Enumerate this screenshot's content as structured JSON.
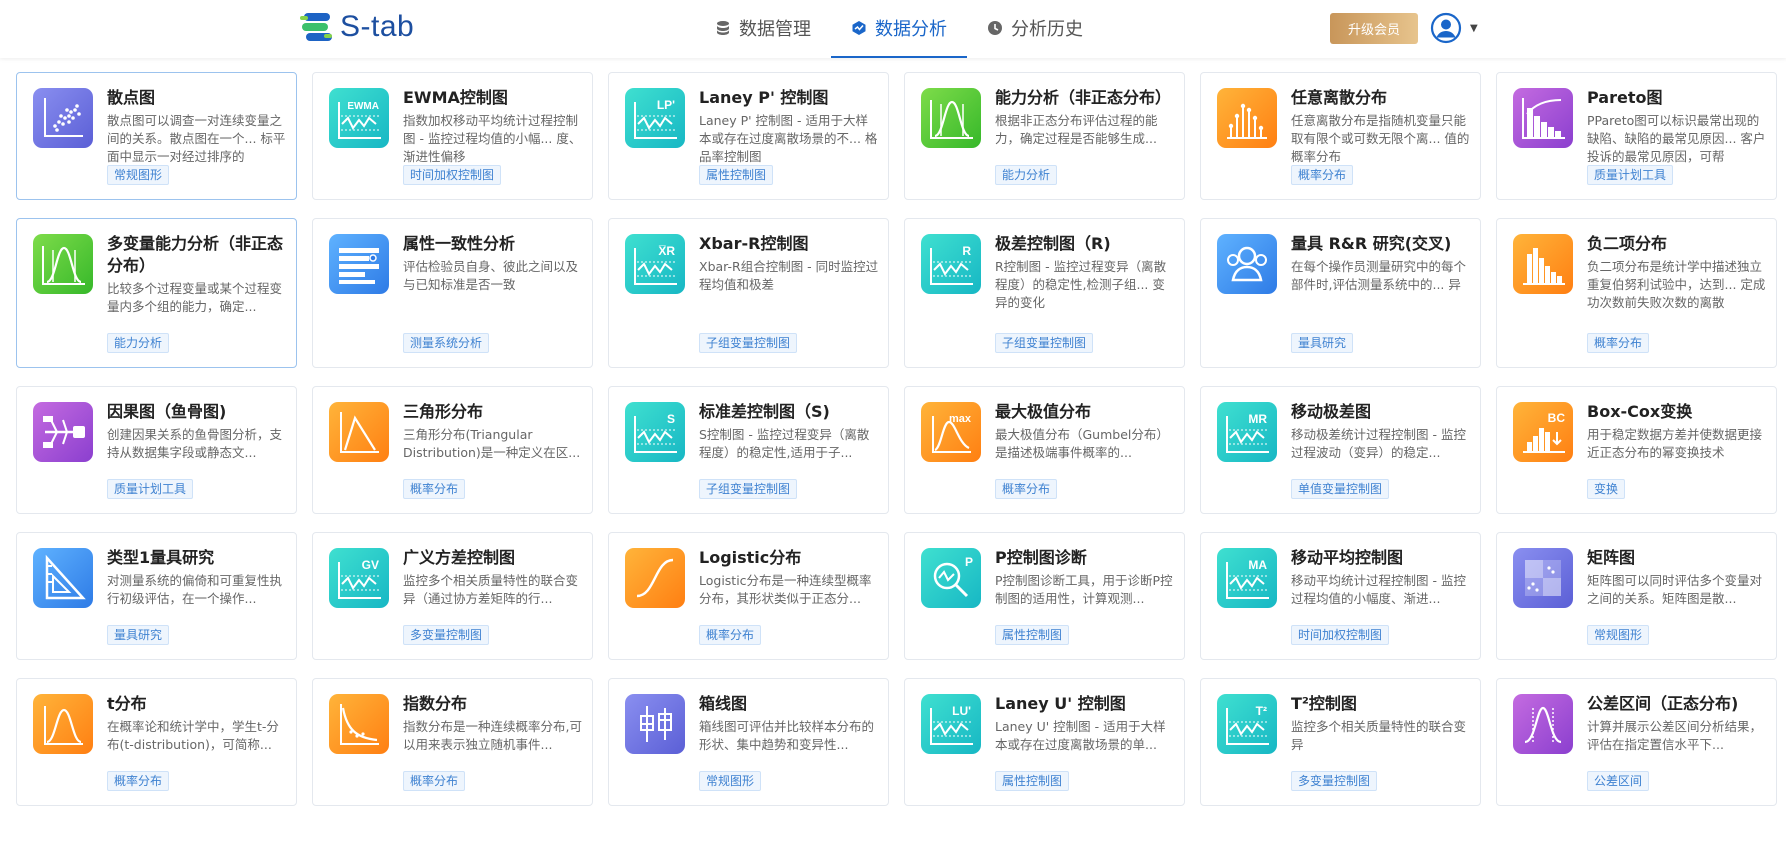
{
  "header": {
    "logo_text": "S-tab",
    "nav": [
      {
        "label": "数据管理",
        "icon": "database-icon"
      },
      {
        "label": "数据分析",
        "icon": "analysis-icon"
      },
      {
        "label": "分析历史",
        "icon": "clock-icon"
      }
    ],
    "active_nav": 1,
    "upgrade_label": "升级会员",
    "accent": "#1a66c9"
  },
  "cards": [
    {
      "title": "散点图",
      "desc": "散点图可以调查一对连续变量之间的关系。散点图在一个... 标平面中显示一对经过排序的",
      "tag": "常规图形",
      "icon": "scatter-icon",
      "color": "purple",
      "badge": ""
    },
    {
      "title": "EWMA控制图",
      "desc": "指数加权移动平均统计过程控制图 - 监控过程均值的小幅... 度、渐进性偏移",
      "tag": "时间加权控制图",
      "icon": "control-chart-icon",
      "color": "teal",
      "badge": "EWMA"
    },
    {
      "title": "Laney P' 控制图",
      "desc": "Laney P' 控制图 - 适用于大样本或存在过度离散场景的不... 格品率控制图",
      "tag": "属性控制图",
      "icon": "control-chart-icon",
      "color": "teal",
      "badge": "LP'"
    },
    {
      "title": "能力分析（非正态分布）",
      "desc": "根据非正态分布评估过程的能力，确定过程是否能够生成...",
      "tag": "能力分析",
      "icon": "capability-icon",
      "color": "green",
      "badge": ""
    },
    {
      "title": "任意离散分布",
      "desc": "任意离散分布是指随机变量只能取有限个或可数无限个离... 值的概率分布",
      "tag": "概率分布",
      "icon": "discrete-distribution-icon",
      "color": "orange",
      "badge": ""
    },
    {
      "title": "Pareto图",
      "desc": "PPareto图可以标识最常出现的缺陷、缺陷的最常见原因... 客户投诉的最常见原因，可帮",
      "tag": "质量计划工具",
      "icon": "pareto-icon",
      "color": "purple2",
      "badge": ""
    },
    {
      "title": "多变量能力分析（非正态分布）",
      "desc": "比较多个过程变量或某个过程变量内多个组的能力，确定...",
      "tag": "能力分析",
      "icon": "capability-icon",
      "color": "green",
      "badge": ""
    },
    {
      "title": "属性一致性分析",
      "desc": "评估检验员自身、彼此之间以及与已知标准是否一致",
      "tag": "测量系统分析",
      "icon": "attribute-agreement-icon",
      "color": "blue",
      "badge": ""
    },
    {
      "title": "Xbar-R控制图",
      "desc": "Xbar-R组合控制图 - 同时监控过程均值和极差",
      "tag": "子组变量控制图",
      "icon": "control-chart-icon",
      "color": "teal",
      "badge": "X̅R"
    },
    {
      "title": "极差控制图（R)",
      "desc": "R控制图 - 监控过程变异（离散程度）的稳定性,检测子组... 变异的变化",
      "tag": "子组变量控制图",
      "icon": "control-chart-icon",
      "color": "teal",
      "badge": "R"
    },
    {
      "title": "量具 R&R 研究(交叉)",
      "desc": "在每个操作员测量研究中的每个部件时,评估测量系统中的... 异",
      "tag": "量具研究",
      "icon": "people-icon",
      "color": "blue",
      "badge": ""
    },
    {
      "title": "负二项分布",
      "desc": "负二项分布是统计学中描述独立重复伯努利试验中，达到... 定成功次数前失败次数的离散",
      "tag": "概率分布",
      "icon": "histogram-icon",
      "color": "orange",
      "badge": ""
    },
    {
      "title": "因果图（鱼骨图)",
      "desc": "创建因果关系的鱼骨图分析，支持从数据集字段或静态文...",
      "tag": "质量计划工具",
      "icon": "fishbone-icon",
      "color": "purple2",
      "badge": ""
    },
    {
      "title": "三角形分布",
      "desc": "三角形分布(Triangular Distribution)是一种定义在区...",
      "tag": "概率分布",
      "icon": "triangle-distribution-icon",
      "color": "orange",
      "badge": ""
    },
    {
      "title": "标准差控制图（S)",
      "desc": "S控制图 - 监控过程变异（离散程度）的稳定性,适用于子...",
      "tag": "子组变量控制图",
      "icon": "control-chart-icon",
      "color": "teal",
      "badge": "S"
    },
    {
      "title": "最大极值分布",
      "desc": "最大极值分布（Gumbel分布）是描述极端事件概率的...",
      "tag": "概率分布",
      "icon": "extreme-value-icon",
      "color": "orange",
      "badge": "max"
    },
    {
      "title": "移动极差图",
      "desc": "移动极差统计过程控制图 - 监控过程波动（变异）的稳定...",
      "tag": "单值变量控制图",
      "icon": "control-chart-icon",
      "color": "teal",
      "badge": "MR"
    },
    {
      "title": "Box-Cox变换",
      "desc": "用于稳定数据方差并使数据更接近正态分布的幂变换技术",
      "tag": "变换",
      "icon": "boxcox-icon",
      "color": "orange",
      "badge": "BC"
    },
    {
      "title": "类型1量具研究",
      "desc": "对测量系统的偏倚和可重复性执行初级评估，在一个操作...",
      "tag": "量具研究",
      "icon": "ruler-icon",
      "color": "blue",
      "badge": ""
    },
    {
      "title": "广义方差控制图",
      "desc": "监控多个相关质量特性的联合变异（通过协方差矩阵的行...",
      "tag": "多变量控制图",
      "icon": "control-chart-icon",
      "color": "teal",
      "badge": "GV"
    },
    {
      "title": "Logistic分布",
      "desc": "Logistic分布是一种连续型概率分布，其形状类似于正态分...",
      "tag": "概率分布",
      "icon": "logistic-icon",
      "color": "orange",
      "badge": ""
    },
    {
      "title": "P控制图诊断",
      "desc": "P控制图诊断工具，用于诊断P控制图的适用性，计算观测...",
      "tag": "属性控制图",
      "icon": "diagnosis-icon",
      "color": "teal",
      "badge": "P"
    },
    {
      "title": "移动平均控制图",
      "desc": "移动平均统计过程控制图 - 监控过程均值的小幅度、渐进...",
      "tag": "时间加权控制图",
      "icon": "control-chart-icon",
      "color": "teal",
      "badge": "MA"
    },
    {
      "title": "矩阵图",
      "desc": "矩阵图可以同时评估多个变量对之间的关系。矩阵图是散...",
      "tag": "常规图形",
      "icon": "matrix-icon",
      "color": "purple",
      "badge": ""
    },
    {
      "title": "t分布",
      "desc": "在概率论和统计学中，学生t-分布(t-distribution)，可简称...",
      "tag": "概率分布",
      "icon": "bell-curve-icon",
      "color": "orange",
      "badge": ""
    },
    {
      "title": "指数分布",
      "desc": "指数分布是一种连续概率分布,可以用来表示独立随机事件...",
      "tag": "概率分布",
      "icon": "exponential-icon",
      "color": "orange",
      "badge": ""
    },
    {
      "title": "箱线图",
      "desc": "箱线图可评估并比较样本分布的形状、集中趋势和变异性...",
      "tag": "常规图形",
      "icon": "boxplot-icon",
      "color": "purple",
      "badge": ""
    },
    {
      "title": "Laney U' 控制图",
      "desc": "Laney U' 控制图 - 适用于大样本或存在过度离散场景的单...",
      "tag": "属性控制图",
      "icon": "control-chart-icon",
      "color": "teal",
      "badge": "LU'"
    },
    {
      "title": "T²控制图",
      "desc": "监控多个相关质量特性的联合变异",
      "tag": "多变量控制图",
      "icon": "control-chart-icon",
      "color": "teal",
      "badge": "T²"
    },
    {
      "title": "公差区间（正态分布)",
      "desc": "计算并展示公差区间分析结果，评估在指定置信水平下...",
      "tag": "公差区间",
      "icon": "tolerance-icon",
      "color": "purple2",
      "badge": ""
    }
  ],
  "colors": {
    "purple": [
      "#8a8ff0",
      "#5b5fd6"
    ],
    "purple2": [
      "#c46be0",
      "#8b3fcf"
    ],
    "teal": [
      "#3fe0d0",
      "#17b7c4"
    ],
    "green": [
      "#7edc4a",
      "#36b82a"
    ],
    "orange": [
      "#ffb43a",
      "#ff7f12"
    ],
    "blue": [
      "#5fb2ff",
      "#2e7be6"
    ]
  },
  "selected_cards": [
    0,
    6
  ]
}
